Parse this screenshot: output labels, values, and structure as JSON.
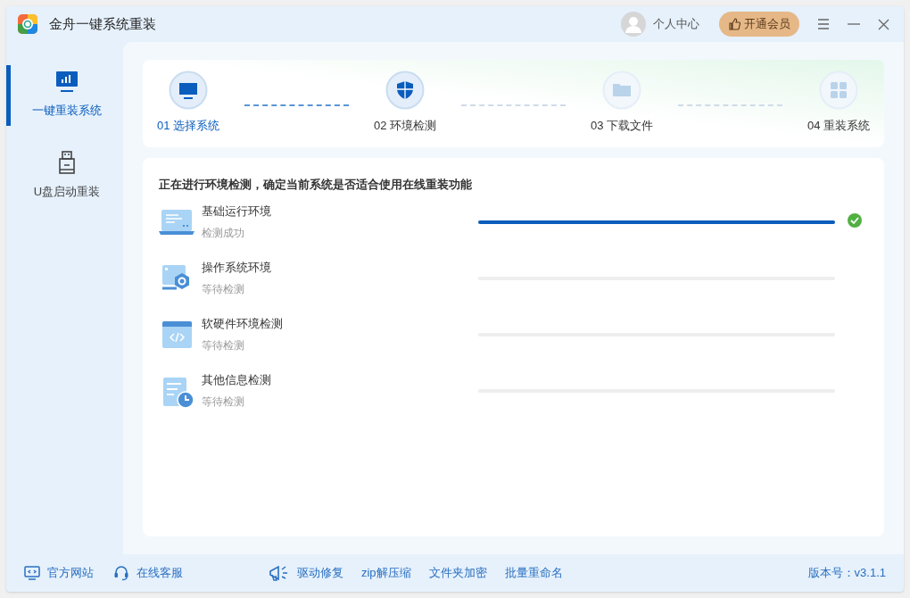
{
  "window": {
    "title": "金舟一键系统重装",
    "user_label": "个人中心",
    "vip_button": "开通会员"
  },
  "sidebar": {
    "items": [
      {
        "label": "一键重装系统",
        "kind": "monitor",
        "selected": true
      },
      {
        "label": "U盘启动重装",
        "kind": "usb",
        "selected": false
      }
    ]
  },
  "steps": [
    {
      "label": "01 选择系统",
      "kind": "monitor",
      "selected": true,
      "reached": true
    },
    {
      "label": "02 环境检测",
      "kind": "shield",
      "selected": false,
      "reached": true
    },
    {
      "label": "03 下载文件",
      "kind": "folder",
      "selected": false,
      "reached": false
    },
    {
      "label": "04 重装系统",
      "kind": "grid",
      "selected": false,
      "reached": false
    }
  ],
  "check_panel": {
    "heading": "正在进行环境检测，确定当前系统是否适合使用在线重装功能",
    "items": [
      {
        "name": "基础运行环境",
        "status": "检测成功",
        "kind": "laptop",
        "done": true,
        "level": 1
      },
      {
        "name": "操作系统环境",
        "status": "等待检测",
        "kind": "gear",
        "done": false,
        "level": 0
      },
      {
        "name": "软硬件环境检测",
        "status": "等待检测",
        "kind": "code",
        "done": false,
        "level": 0
      },
      {
        "name": "其他信息检测",
        "status": "等待检测",
        "kind": "clock",
        "done": false,
        "level": 0
      }
    ]
  },
  "footer": {
    "left_links": [
      {
        "label": "官方网站",
        "kind": "web"
      },
      {
        "label": "在线客服",
        "kind": "headset"
      }
    ],
    "tools": [
      "驱动修复",
      "zip解压缩",
      "文件夹加密",
      "批量重命名"
    ],
    "version": "版本号：v3.1.1"
  }
}
